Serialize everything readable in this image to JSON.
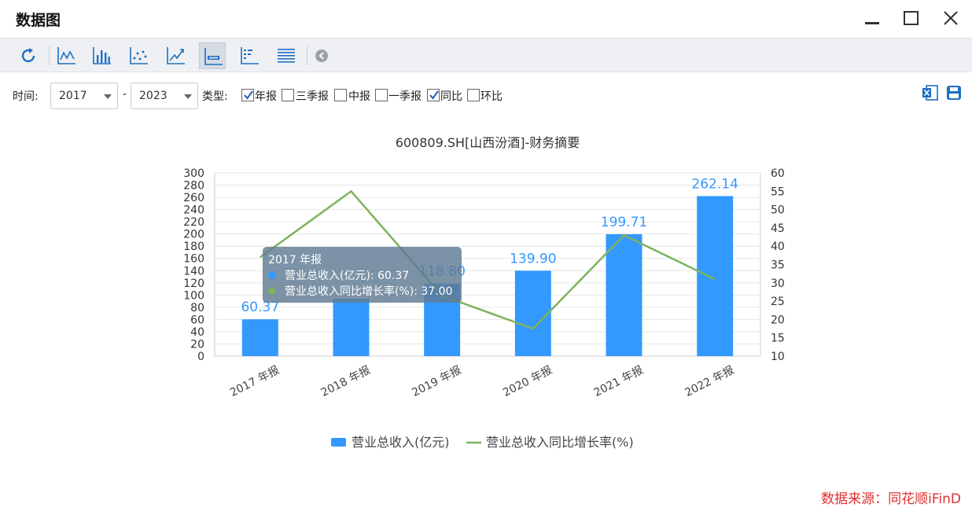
{
  "window": {
    "title": "数据图",
    "controls": [
      "minimize-icon",
      "maximize-icon",
      "close-icon"
    ]
  },
  "toolbar": {
    "buttons": [
      {
        "name": "refresh",
        "icon": "refresh-icon"
      },
      {
        "name": "line-chart",
        "icon": "line-chart-icon"
      },
      {
        "name": "bar-chart",
        "icon": "bar-chart-icon"
      },
      {
        "name": "scatter-chart",
        "icon": "scatter-chart-icon"
      },
      {
        "name": "trend-chart",
        "icon": "trend-chart-icon"
      },
      {
        "name": "combo-chart",
        "icon": "combo-chart-icon",
        "active": true
      },
      {
        "name": "data-table",
        "icon": "data-table-icon"
      },
      {
        "name": "list-view",
        "icon": "list-view-icon"
      },
      {
        "name": "collapse",
        "icon": "chevron-left-circle-icon"
      }
    ]
  },
  "filters": {
    "time_label": "时间:",
    "from_year": "2017",
    "dash": "-",
    "to_year": "2023",
    "type_label": "类型:",
    "options": [
      {
        "label": "年报",
        "checked": true
      },
      {
        "label": "三季报",
        "checked": false
      },
      {
        "label": "中报",
        "checked": false
      },
      {
        "label": "一季报",
        "checked": false
      },
      {
        "label": "同比",
        "checked": true
      },
      {
        "label": "环比",
        "checked": false
      }
    ],
    "export_icons": [
      "excel-export-icon",
      "save-icon"
    ]
  },
  "colors": {
    "bar": "#3399ff",
    "line": "#7db35d",
    "label": "#3399ff",
    "source": "#e03030",
    "tooltip_bg": "#5f7a93"
  },
  "chart_data": {
    "type": "bar",
    "title": "600809.SH[山西汾酒]-财务摘要",
    "categories": [
      "2017 年报",
      "2018 年报",
      "2019 年报",
      "2020 年报",
      "2021 年报",
      "2022 年报"
    ],
    "series": [
      {
        "name": "营业总收入(亿元)",
        "type": "bar",
        "axis": "left",
        "values": [
          60.37,
          94.0,
          118.8,
          139.9,
          199.71,
          262.14
        ],
        "labels": [
          "60.37",
          "",
          "118.80",
          "139.90",
          "199.71",
          "262.14"
        ]
      },
      {
        "name": "营业总收入同比增长率(%)",
        "type": "line",
        "axis": "right",
        "values": [
          37.0,
          55.0,
          26.5,
          17.5,
          43.0,
          31.0
        ]
      }
    ],
    "left_axis": {
      "ylim": [
        0,
        300
      ],
      "ticks": [
        "0",
        "20",
        "40",
        "60",
        "80",
        "100",
        "120",
        "140",
        "160",
        "180",
        "200",
        "220",
        "240",
        "260",
        "280",
        "300"
      ]
    },
    "right_axis": {
      "ylim": [
        10,
        60
      ],
      "ticks": [
        "10",
        "15",
        "20",
        "25",
        "30",
        "35",
        "40",
        "45",
        "50",
        "55",
        "60"
      ]
    },
    "grid": true,
    "legend": "bottom-center",
    "tooltip": {
      "title": "2017 年报",
      "rows": [
        {
          "text": "营业总收入(亿元): 60.37",
          "color": "#3399ff"
        },
        {
          "text": "营业总收入同比增长率(%): 37.00",
          "color": "#7db35d"
        }
      ]
    }
  },
  "source_text": "数据来源：同花顺iFinD"
}
